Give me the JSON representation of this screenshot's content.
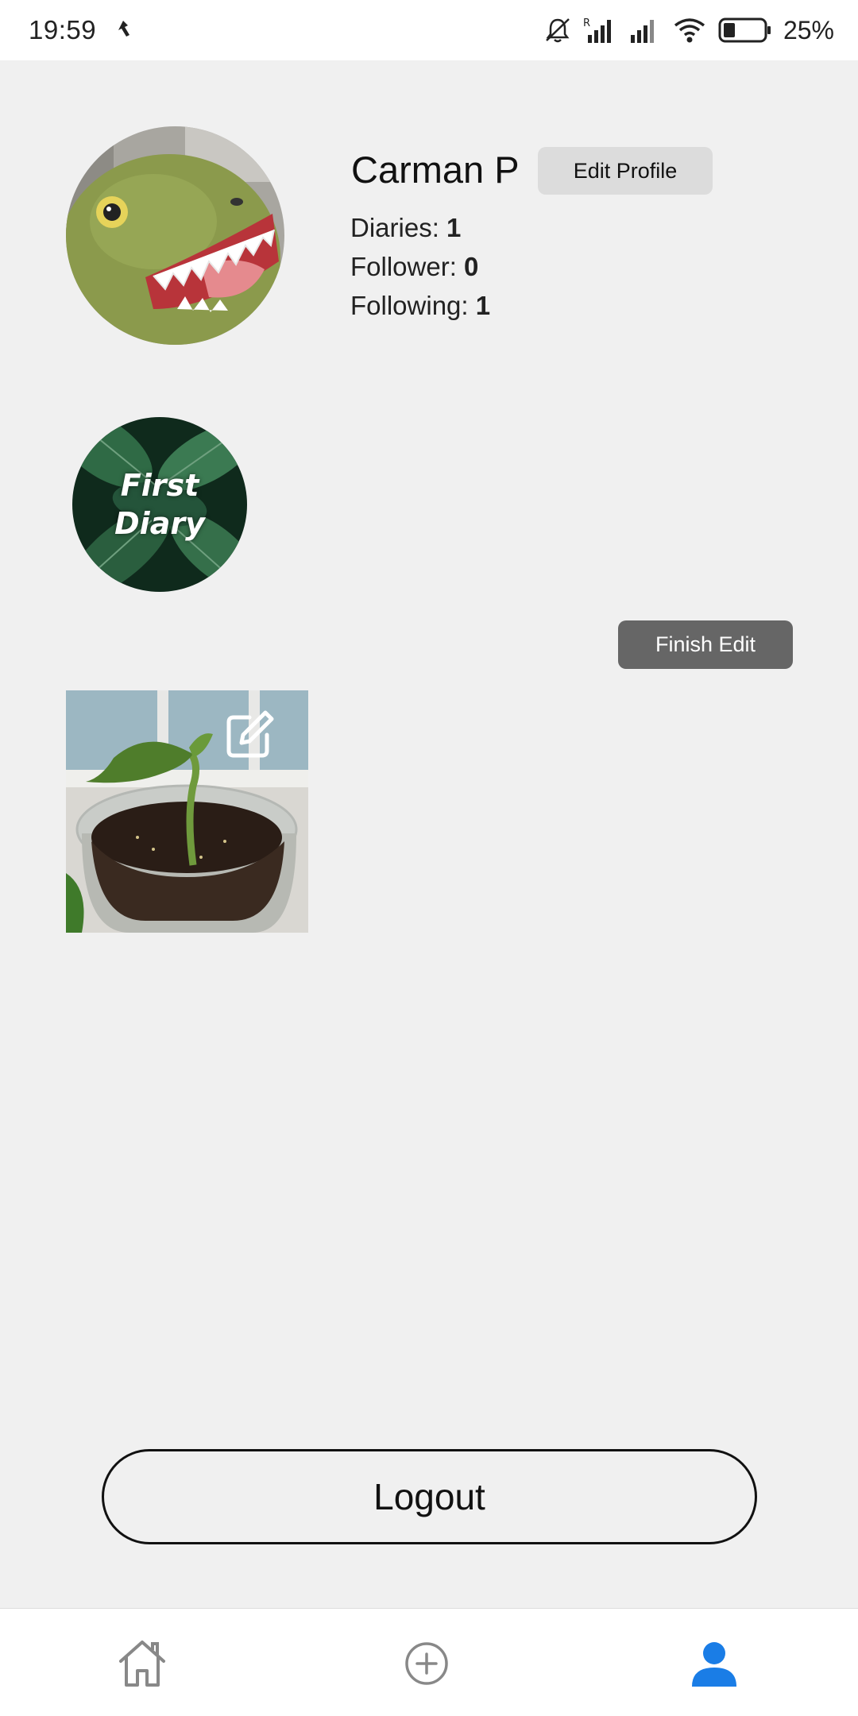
{
  "status_bar": {
    "time": "19:59",
    "battery_text": "25%"
  },
  "profile": {
    "name": "Carman P",
    "edit_button": "Edit Profile",
    "stats": [
      {
        "label": "Diaries: ",
        "value": "1"
      },
      {
        "label": "Follower: ",
        "value": "0"
      },
      {
        "label": "Following: ",
        "value": "1"
      }
    ]
  },
  "highlight": {
    "line1": "First",
    "line2": "Diary"
  },
  "edit_mode": {
    "finish_button": "Finish Edit"
  },
  "logout": {
    "label": "Logout"
  },
  "bottom_nav": {
    "items": [
      {
        "icon": "home-icon",
        "active": false
      },
      {
        "icon": "add-circle-icon",
        "active": false
      },
      {
        "icon": "person-icon",
        "active": true
      }
    ],
    "active_color": "#1a7de6",
    "inactive_color": "#888888"
  }
}
